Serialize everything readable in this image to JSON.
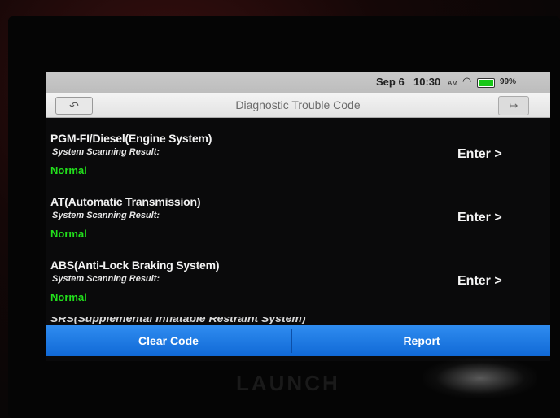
{
  "status_bar": {
    "date": "Sep 6",
    "time": "10:30",
    "ampm": "AM",
    "wifi_icon": "wifi-icon",
    "battery_level": 0.99,
    "battery_text": "99%"
  },
  "titlebar": {
    "back_icon": "back-arrow-icon",
    "title": "Diagnostic Trouble Code",
    "exit_icon": "exit-icon"
  },
  "systems": [
    {
      "name": "PGM-FI/Diesel(Engine System)",
      "label": "System Scanning Result:",
      "value": "Normal",
      "action": "Enter >"
    },
    {
      "name": "AT(Automatic Transmission)",
      "label": "System Scanning Result:",
      "value": "Normal",
      "action": "Enter >"
    },
    {
      "name": "ABS(Anti-Lock Braking System)",
      "label": "System Scanning Result:",
      "value": "Normal",
      "action": "Enter >"
    }
  ],
  "partial_item": "SRS(Supplemental Inflatable Restraint System)",
  "buttons": {
    "clear": "Clear Code",
    "report": "Report"
  },
  "device_brand": "LAUNCH",
  "colors": {
    "normal": "#22e01c",
    "button_blue": "#1f7ae5",
    "screen_bg": "#0a0a0b"
  }
}
